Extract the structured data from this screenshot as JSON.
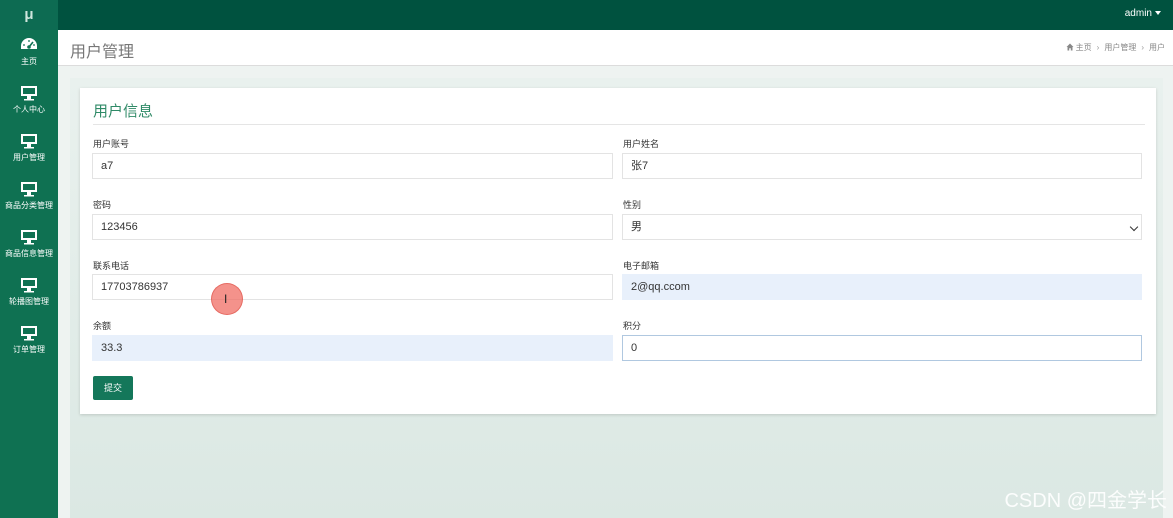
{
  "brand": "μ",
  "user_menu": "admin",
  "sidebar": {
    "items": [
      {
        "label": "主页",
        "icon": "dashboard-icon"
      },
      {
        "label": "个人中心",
        "icon": "monitor-icon"
      },
      {
        "label": "用户管理",
        "icon": "monitor-icon"
      },
      {
        "label": "商品分类管理",
        "icon": "monitor-icon"
      },
      {
        "label": "商品信息管理",
        "icon": "monitor-icon"
      },
      {
        "label": "轮播图管理",
        "icon": "monitor-icon"
      },
      {
        "label": "订单管理",
        "icon": "monitor-icon"
      }
    ]
  },
  "header": {
    "title": "用户管理",
    "breadcrumb": [
      "主页",
      "用户管理",
      "用户"
    ]
  },
  "form": {
    "title": "用户信息",
    "fields": {
      "account": {
        "label": "用户账号",
        "value": "a7"
      },
      "name": {
        "label": "用户姓名",
        "value": "张7"
      },
      "password": {
        "label": "密码",
        "value": "123456"
      },
      "gender": {
        "label": "性别",
        "value": "男"
      },
      "phone": {
        "label": "联系电话",
        "value": "17703786937"
      },
      "email": {
        "label": "电子邮箱",
        "value": "2@qq.ccom"
      },
      "balance": {
        "label": "余额",
        "value": "33.3"
      },
      "points": {
        "label": "积分",
        "value": "0"
      }
    },
    "submit_label": "提交"
  },
  "cursor_glyph": "I",
  "watermark": "CSDN @四金学长",
  "colors": {
    "topbar": "#00523f",
    "sidebar": "#0f7152",
    "accent": "#2f8a67",
    "button": "#14775a"
  }
}
